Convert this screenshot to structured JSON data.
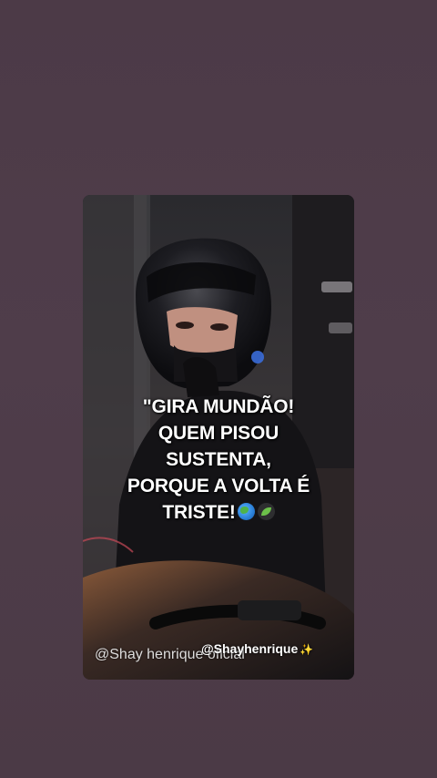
{
  "post": {
    "caption_lines": [
      "\"GIRA MUNDÃO!",
      "QUEM PISOU",
      "SUSTENTA,",
      "PORQUE A VOLTA É",
      "TRISTE!"
    ],
    "emojis": [
      "globe-icon",
      "leaf-icon"
    ],
    "watermark_primary": "@Shay henrique oficial",
    "watermark_secondary": "@Shayhenrique",
    "sparkle": "✨"
  },
  "colors": {
    "background": "#4c3a47",
    "caption": "#ffffff"
  }
}
